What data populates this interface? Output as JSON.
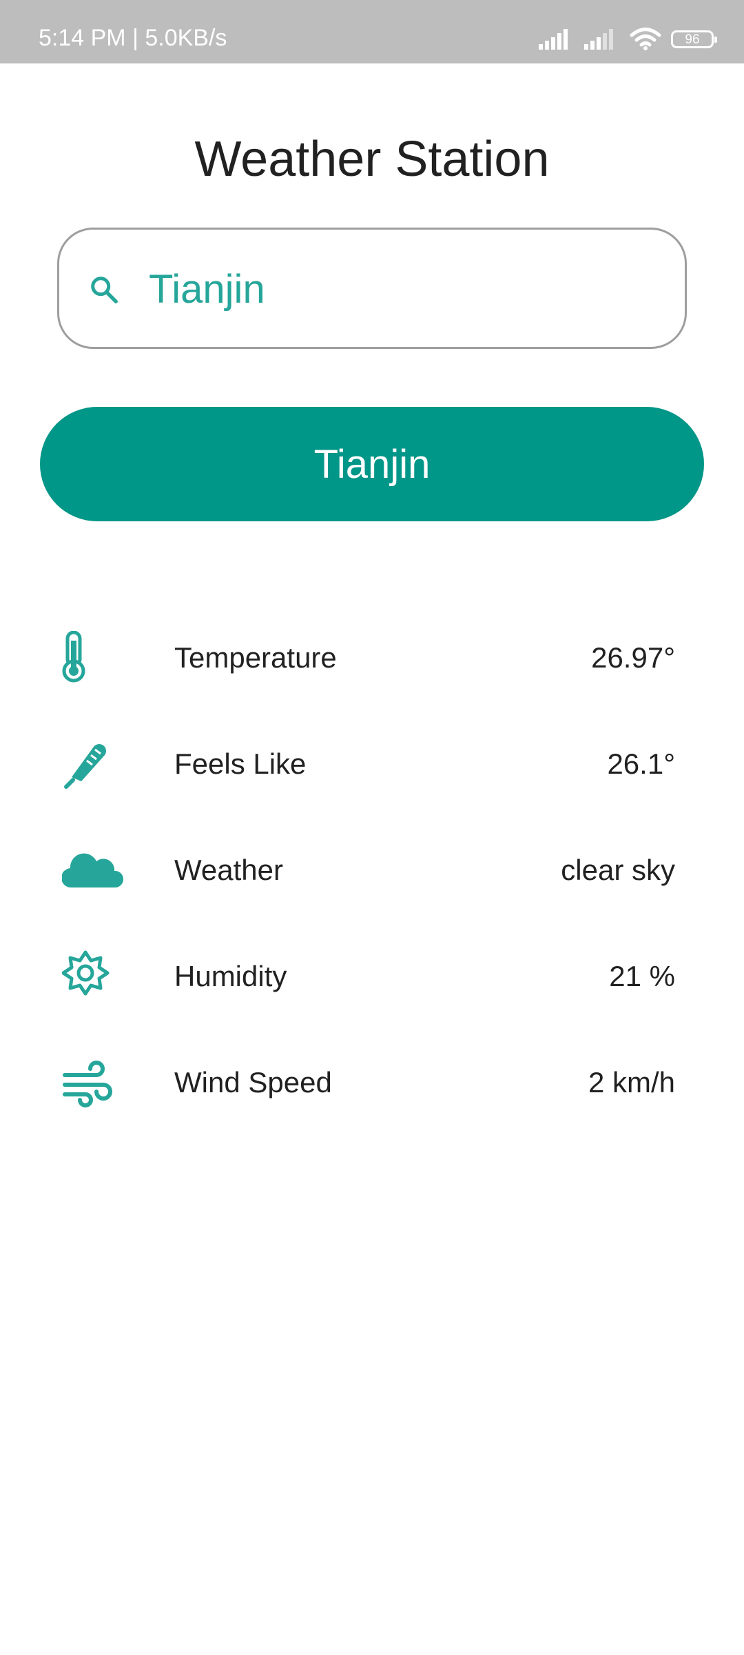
{
  "status_bar": {
    "time_speed": "5:14 PM | 5.0KB/s",
    "battery": "96"
  },
  "app": {
    "title": "Weather Station"
  },
  "search": {
    "value": "Tianjin",
    "icon": "search-icon"
  },
  "button": {
    "label": "Tianjin"
  },
  "rows": [
    {
      "icon": "thermometer-icon",
      "label": "Temperature",
      "value": "26.97°"
    },
    {
      "icon": "thermometer-tilted-icon",
      "label": "Feels Like",
      "value": "26.1°"
    },
    {
      "icon": "cloud-icon",
      "label": "Weather",
      "value": "clear sky"
    },
    {
      "icon": "sun-gear-icon",
      "label": "Humidity",
      "value": "21 %"
    },
    {
      "icon": "wind-icon",
      "label": "Wind Speed",
      "value": "2 km/h"
    }
  ],
  "colors": {
    "accent": "#009688",
    "icon": "#26a69a",
    "status_bar": "#bdbdbd",
    "text": "#212121"
  }
}
